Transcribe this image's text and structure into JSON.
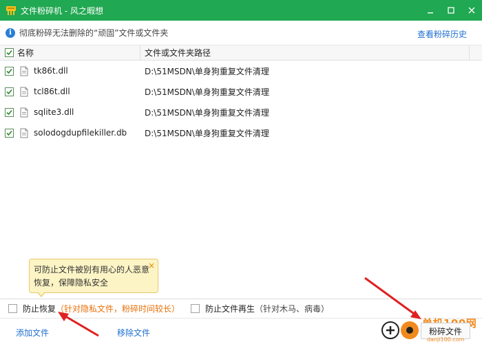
{
  "window": {
    "title": "文件粉碎机 - 风之暇想",
    "buttons": [
      "minimize",
      "maximize",
      "close"
    ]
  },
  "info": {
    "text": "彻底粉碎无法删除的“顽固”文件或文件夹",
    "history_link": "查看粉碎历史"
  },
  "table": {
    "columns": [
      "名称",
      "文件或文件夹路径"
    ],
    "rows": [
      {
        "name": "tk86t.dll",
        "path": "D:\\51MSDN\\单身狗重复文件清理",
        "checked": true
      },
      {
        "name": "tcl86t.dll",
        "path": "D:\\51MSDN\\单身狗重复文件清理",
        "checked": true
      },
      {
        "name": "sqlite3.dll",
        "path": "D:\\51MSDN\\单身狗重复文件清理",
        "checked": true
      },
      {
        "name": "solodogdupfilekiller.db",
        "path": "D:\\51MSDN\\单身狗重复文件清理",
        "checked": true
      }
    ]
  },
  "tooltip": {
    "line1": "可防止文件被别有用心的人恶意",
    "line2": "恢复，保障隐私安全",
    "close": "×"
  },
  "options": {
    "prevent_recovery_label": "防止恢复",
    "prevent_recovery_note": "（针对隐私文件，粉碎时间较长）",
    "prevent_regen_label": "防止文件再生",
    "prevent_regen_note": "（针对木马、病毒）"
  },
  "bottom": {
    "add_file": "添加文件",
    "remove_file": "移除文件",
    "shred": "粉碎文件"
  },
  "watermark": {
    "text": "单机100网",
    "url": "danji100.com"
  },
  "colors": {
    "titlebar": "#21a852",
    "link": "#1e6fd0",
    "note": "#e8710a",
    "tooltip_bg": "#fdf4c5",
    "arrow": "#e02020"
  }
}
